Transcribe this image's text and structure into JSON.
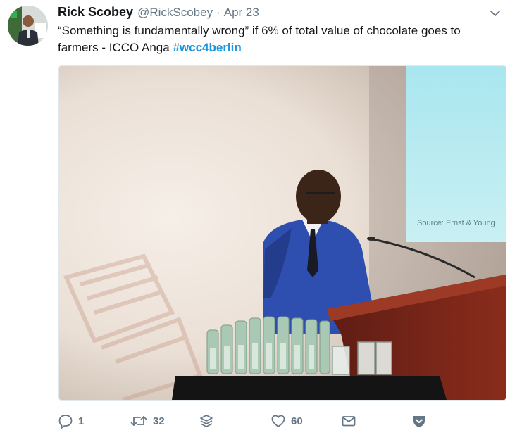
{
  "tweet": {
    "author_name": "Rick Scobey",
    "author_handle": "@RickScobey",
    "separator": "·",
    "date": "Apr 23",
    "text_part1": "“Something is fundamentally wrong” if 6% of total value of chocolate goes to",
    "text_part2": "farmers - ICCO Anga ",
    "hashtag": "#wcc4berlin",
    "slide_source": "Source: Ernst & Young"
  },
  "actions": {
    "reply_count": "1",
    "retweet_count": "32",
    "like_count": "60"
  },
  "icons": {
    "reply": "reply-icon",
    "retweet": "retweet-icon",
    "stack": "stack-icon",
    "like": "heart-icon",
    "dm": "envelope-icon",
    "verified_badge": "shield-check-icon",
    "more": "chevron-down-icon"
  },
  "colors": {
    "link": "#1b95e0",
    "secondary_text": "#657786",
    "primary_text": "#14171a"
  }
}
